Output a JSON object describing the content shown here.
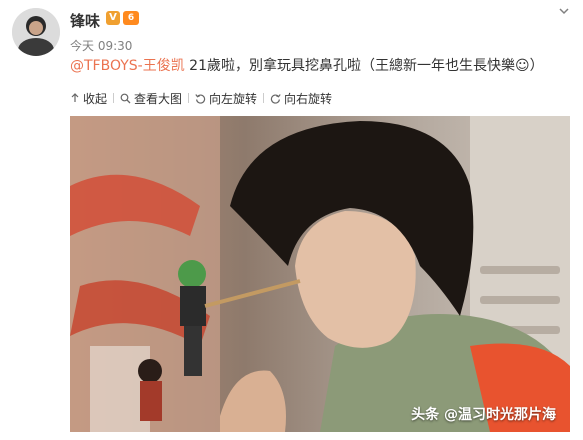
{
  "post": {
    "username": "锋味",
    "vip_badge": "V",
    "level_badge": "6",
    "timestamp": "今天 09:30",
    "mention": "@TFBOYS-王俊凯",
    "text": " 21歲啦，別拿玩具挖鼻孔啦（王總新一年也生長快樂☺）"
  },
  "toolbar": {
    "collapse": "收起",
    "view_large": "查看大图",
    "rotate_left": "向左旋转",
    "rotate_right": "向右旋转"
  },
  "photo": {
    "watermark": "头条 @温习时光那片海"
  },
  "colors": {
    "mention": "#eb7350",
    "text": "#333333",
    "meta": "#808080"
  }
}
